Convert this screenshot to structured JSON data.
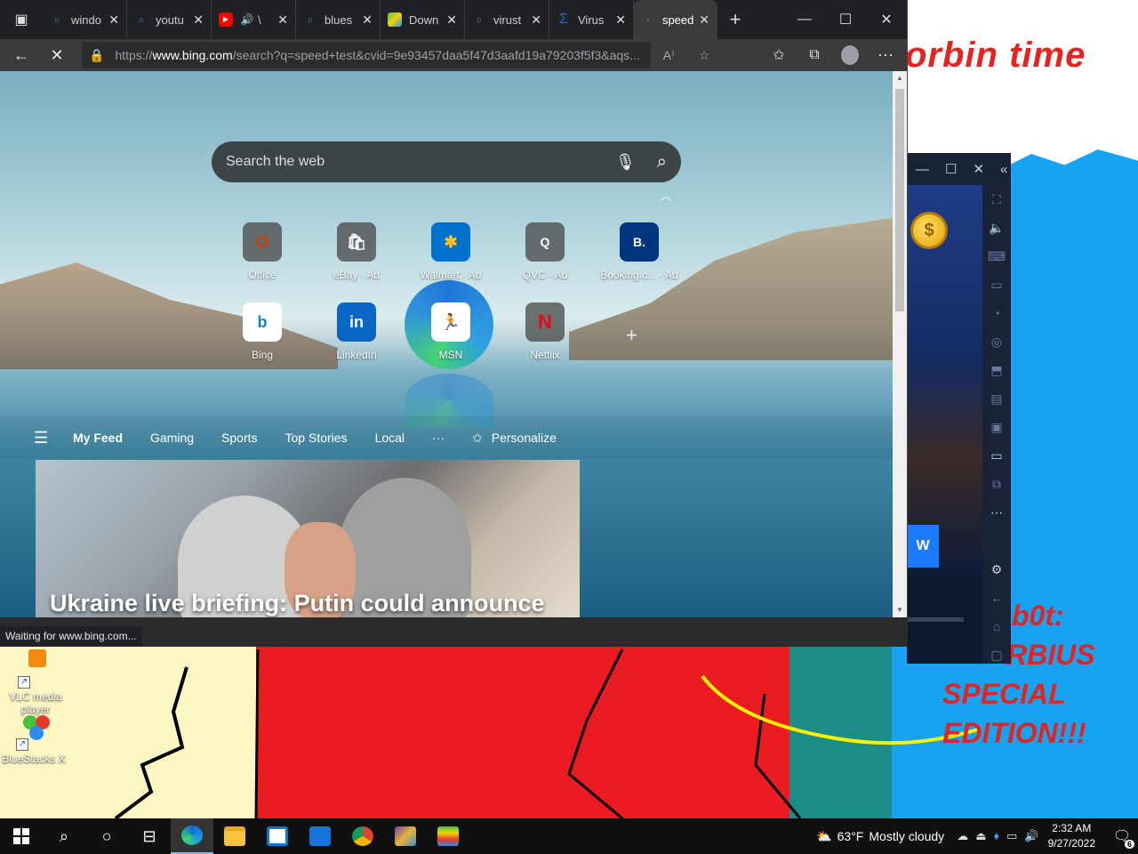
{
  "desktop": {
    "meme_title": "orbin time",
    "meme_caption_lines": [
      "b0t:",
      "RBIUS",
      "SPECIAL",
      "EDITION!!!"
    ],
    "icons": [
      {
        "label": "VLC media player",
        "icon": "vlc-icon"
      },
      {
        "label": "BlueStacks X",
        "icon": "bluestacks-icon"
      }
    ]
  },
  "bluestacks": {
    "title_buttons": [
      "—",
      "☐",
      "✕",
      "«"
    ],
    "game_button_label": "W",
    "coin_symbol": "$"
  },
  "browser": {
    "tabs": [
      {
        "label": "windo",
        "icon": "search-icon"
      },
      {
        "label": "youtu",
        "icon": "search-icon"
      },
      {
        "label": "\\",
        "icon": "youtube-icon",
        "extra": "🔊"
      },
      {
        "label": "blues",
        "icon": "search-icon"
      },
      {
        "label": "Down",
        "icon": "bluestacks-icon"
      },
      {
        "label": "virust",
        "icon": "search-icon"
      },
      {
        "label": "Virus",
        "icon": "virustotal-icon"
      },
      {
        "label": "speed",
        "icon": "loading-icon",
        "active": true
      }
    ],
    "new_tab": "+",
    "window_buttons": {
      "minimize": "—",
      "maximize": "☐",
      "close": "✕"
    },
    "url_host": "www.bing.com",
    "url_prefix": "https://",
    "url_rest": "/search?q=speed+test&cvid=9e93457daa5f47d3aafd19a79203f5f3&aqs...",
    "status": "Waiting for www.bing.com..."
  },
  "newtab_page": {
    "search_placeholder": "Search the web",
    "tiles": [
      {
        "label": "Office",
        "glyph": "O",
        "color": "#d83b01"
      },
      {
        "label": "eBay · Ad",
        "glyph": "🛍",
        "color": "#3a3a3a"
      },
      {
        "label": "Walmart · Ad",
        "glyph": "✱",
        "color": "#0071ce"
      },
      {
        "label": "QVC · Ad",
        "glyph": "Q",
        "color": "#ffffff"
      },
      {
        "label": "Booking.c... · Ad",
        "glyph": "B.",
        "color": "#003580"
      },
      {
        "label": "Bing",
        "glyph": "b",
        "color": "#0a84d6"
      },
      {
        "label": "LinkedIn",
        "glyph": "in",
        "color": "#0a66c2"
      },
      {
        "label": "MSN",
        "glyph": "🏃",
        "color": "#000000"
      },
      {
        "label": "Netflix",
        "glyph": "N",
        "color": "#e50914"
      }
    ],
    "feed": {
      "items": [
        "My Feed",
        "Gaming",
        "Sports",
        "Top Stories",
        "Local",
        "···"
      ],
      "personalize": "Personalize"
    },
    "headline": "Ukraine live briefing: Putin could announce"
  },
  "taskbar": {
    "weather_temp": "63°F",
    "weather_text": "Mostly cloudy",
    "time": "2:32 AM",
    "date": "9/27/2022",
    "notifications": "6"
  }
}
